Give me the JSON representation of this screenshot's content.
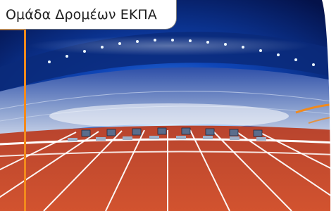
{
  "header": {
    "title": "Ομάδα Δρομέων ΕΚΠΑ"
  },
  "theme": {
    "accent": "#f28a1c",
    "track": "#c9452c",
    "sky": "#0a2d8c",
    "title_border": "#7e7e7e"
  },
  "image": {
    "subject": "stadium-running-track-with-starting-blocks"
  }
}
